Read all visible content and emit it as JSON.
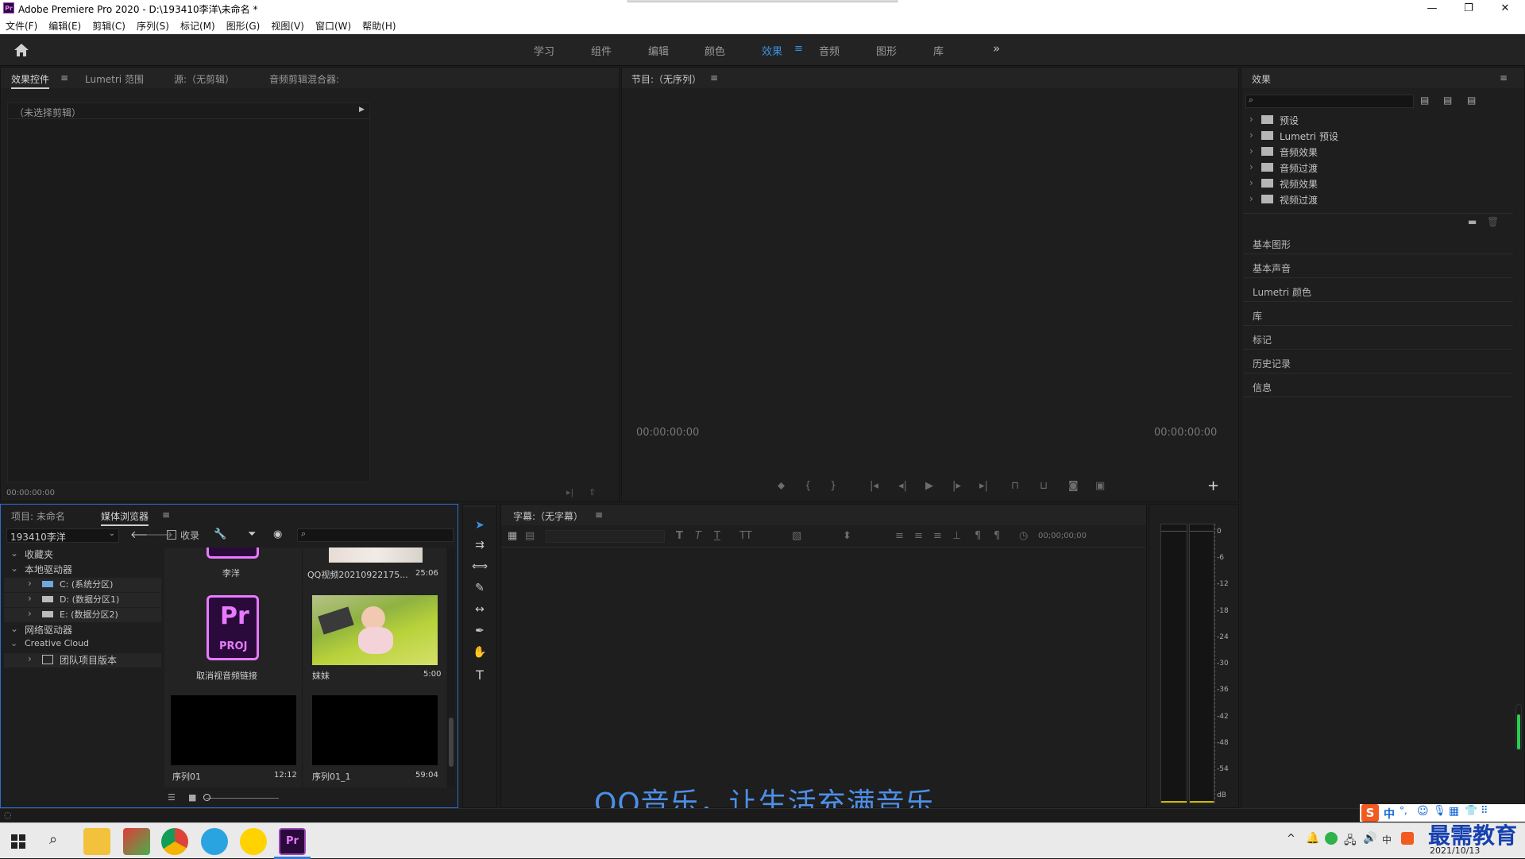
{
  "window": {
    "title": "Adobe Premiere Pro 2020 - D:\\193410李洋\\未命名 *",
    "app_icon": "Pr",
    "minimize": "—",
    "restore": "❐",
    "close": "✕"
  },
  "menu": [
    "文件(F)",
    "编辑(E)",
    "剪辑(C)",
    "序列(S)",
    "标记(M)",
    "图形(G)",
    "视图(V)",
    "窗口(W)",
    "帮助(H)"
  ],
  "workspaces": {
    "items": [
      "学习",
      "组件",
      "编辑",
      "颜色",
      "效果",
      "音频",
      "图形",
      "库"
    ],
    "active": "效果",
    "more": "»"
  },
  "effect_controls": {
    "tabs": [
      "效果控件",
      "Lumetri 范围",
      "源:（无剪辑）",
      "音频剪辑混合器:"
    ],
    "menu_icon": "≡",
    "no_clip": "（未选择剪辑）",
    "timecode": "00:00:00:00"
  },
  "program": {
    "title": "节目:（无序列）",
    "menu_icon": "≡",
    "tc_left": "00:00:00:00",
    "tc_right": "00:00:00:00",
    "add": "+"
  },
  "effects": {
    "title": "效果",
    "menu_icon": "≡",
    "search_placeholder": "",
    "bins": [
      "预设",
      "Lumetri 预设",
      "音频效果",
      "音频过渡",
      "视频效果",
      "视频过渡"
    ],
    "sections": [
      "基本图形",
      "基本声音",
      "Lumetri 颜色",
      "库",
      "标记",
      "历史记录",
      "信息"
    ]
  },
  "project": {
    "tabs": [
      "项目: 未命名",
      "媒体浏览器"
    ],
    "menu_icon": "≡",
    "location": "193410李洋",
    "ingest_label": "收录",
    "tree": [
      {
        "label": "收藏夹",
        "level": 0,
        "expanded": true
      },
      {
        "label": "本地驱动器",
        "level": 0,
        "expanded": true
      },
      {
        "label": "C: (系统分区)",
        "level": 1,
        "expanded": false
      },
      {
        "label": "D: (数据分区1)",
        "level": 1,
        "expanded": false
      },
      {
        "label": "E: (数据分区2)",
        "level": 1,
        "expanded": false
      },
      {
        "label": "网络驱动器",
        "level": 0,
        "expanded": true
      },
      {
        "label": "Creative Cloud",
        "level": 0,
        "expanded": true
      },
      {
        "label": "团队项目版本",
        "level": 1,
        "expanded": false
      }
    ],
    "clips": [
      {
        "name": "李洋",
        "duration": "",
        "kind": "proj-partial"
      },
      {
        "name": "QQ视频20210922175...",
        "duration": "25:06",
        "kind": "video-partial"
      },
      {
        "name": "取消视音频链接",
        "duration": "",
        "kind": "proj"
      },
      {
        "name": "妹妹",
        "duration": "5:00",
        "kind": "photo"
      },
      {
        "name": "序列01",
        "duration": "12:12",
        "kind": "black"
      },
      {
        "name": "序列01_1",
        "duration": "59:04",
        "kind": "black"
      }
    ],
    "proj_icon_top": "Pr",
    "proj_icon_bottom": "PROJ"
  },
  "captions": {
    "title": "字幕:（无字幕）",
    "menu_icon": "≡",
    "timecode": "00;00;00;00"
  },
  "meter": {
    "ticks": [
      "0",
      "-6",
      "-12",
      "-18",
      "-24",
      "-30",
      "-36",
      "-42",
      "-48",
      "-54",
      "dB"
    ]
  },
  "overlay": {
    "subtitle": "QQ音乐，让生活充满音乐",
    "watermark": "最需教育"
  },
  "taskbar": {
    "date": "2021/10/13",
    "ime": [
      "中",
      "°,",
      "☺",
      "🎙",
      "▦",
      "👕",
      "⠿"
    ]
  },
  "colors": {
    "accent_blue": "#2a6fd0",
    "workspace_active": "#3b8fe0",
    "premiere_purple": "#e77bff"
  }
}
